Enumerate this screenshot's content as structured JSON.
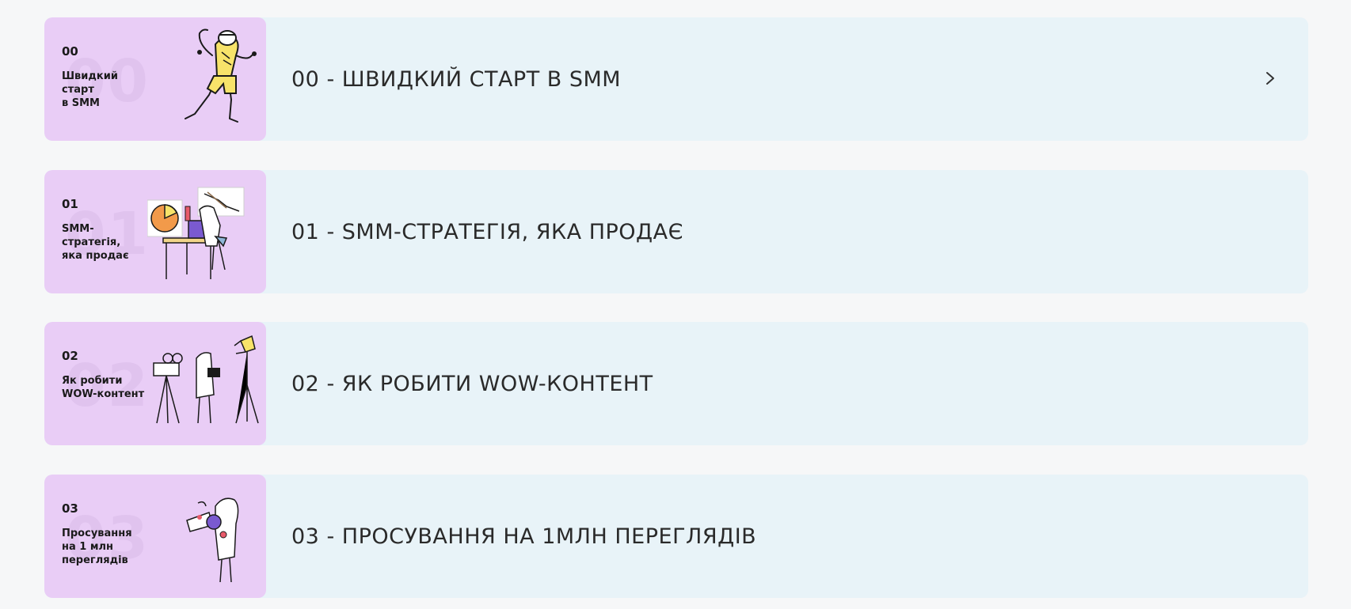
{
  "lessons": [
    {
      "number": "00",
      "ghost_number": "00",
      "thumb_title": "Швидкий\nстарт\nв SMM",
      "title": "00 - ШВИДКИЙ СТАРТ В SMM",
      "illustration": "running-character-illustration",
      "has_chevron": true
    },
    {
      "number": "01",
      "ghost_number": "01",
      "thumb_title": "SMM-\nстратегія,\nяка продає",
      "title": "01 - SMM-СТРАТЕГІЯ, ЯКА ПРОДАЄ",
      "illustration": "strategy-desk-illustration",
      "has_chevron": false
    },
    {
      "number": "02",
      "ghost_number": "02",
      "thumb_title": "Як робити\nWOW-контент",
      "title": "02 - ЯК РОБИТИ WOW-КОНТЕНТ",
      "illustration": "video-shoot-illustration",
      "has_chevron": false
    },
    {
      "number": "03",
      "ghost_number": "03",
      "thumb_title": "Просування\nна 1 млн\nпереглядів",
      "title": "03 - ПРОСУВАННЯ НА 1МЛН ПЕРЕГЛЯДІВ",
      "illustration": "megaphone-character-illustration",
      "has_chevron": false
    }
  ],
  "colors": {
    "page_bg": "#f6f7f8",
    "card_bg": "#e8f3f8",
    "thumb_bg": "#e9cdf6",
    "accent_yellow": "#f7e36a",
    "accent_orange": "#f29a4a",
    "accent_purple": "#7a5ad0"
  }
}
